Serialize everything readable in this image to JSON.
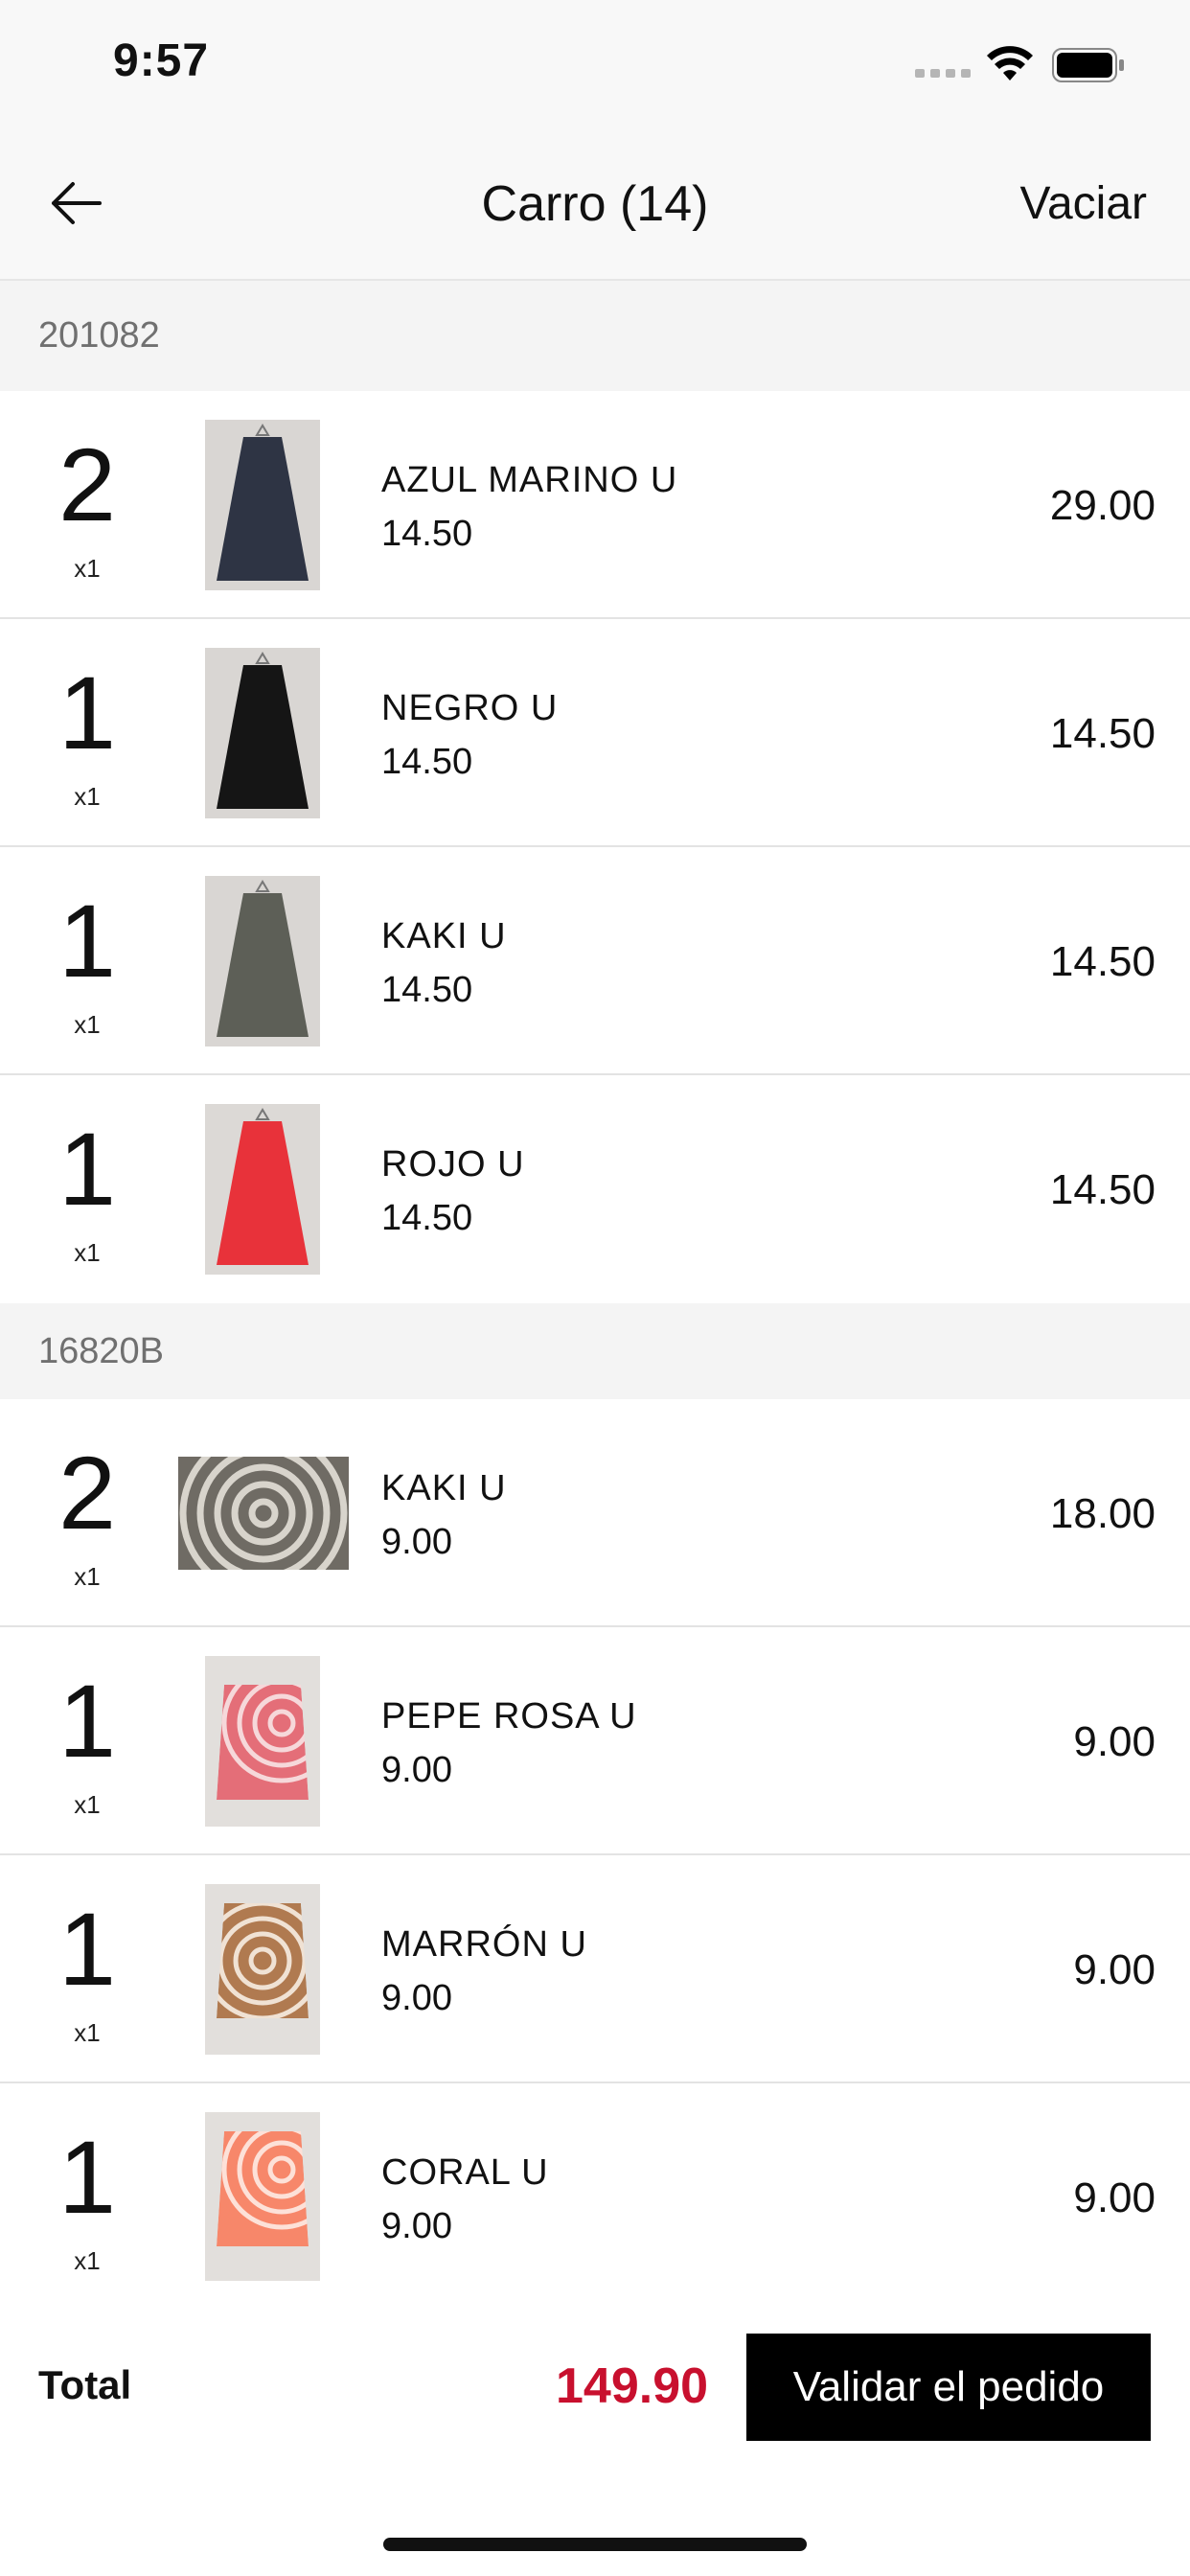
{
  "status_bar": {
    "time": "9:57"
  },
  "header": {
    "title": "Carro (14)",
    "clear_label": "Vaciar",
    "back_icon": "arrow-left-icon"
  },
  "sections": [
    {
      "code": "201082",
      "items": [
        {
          "qty": "2",
          "multiplier": "x1",
          "name": "AZUL MARINO  U",
          "unit_price": "14.50",
          "line_total": "29.00",
          "color": "#2e3444"
        },
        {
          "qty": "1",
          "multiplier": "x1",
          "name": "NEGRO U",
          "unit_price": "14.50",
          "line_total": "14.50",
          "color": "#151515"
        },
        {
          "qty": "1",
          "multiplier": "x1",
          "name": "KAKI U",
          "unit_price": "14.50",
          "line_total": "14.50",
          "color": "#5d5f57"
        },
        {
          "qty": "1",
          "multiplier": "x1",
          "name": "ROJO U",
          "unit_price": "14.50",
          "line_total": "14.50",
          "color": "#e8323a"
        }
      ]
    },
    {
      "code": "16820B",
      "items": [
        {
          "qty": "2",
          "multiplier": "x1",
          "name": "KAKI U",
          "unit_price": "9.00",
          "line_total": "18.00",
          "color": "#6f6b64"
        },
        {
          "qty": "1",
          "multiplier": "x1",
          "name": "PEPE ROSA U",
          "unit_price": "9.00",
          "line_total": "9.00",
          "color": "#e46e78"
        },
        {
          "qty": "1",
          "multiplier": "x1",
          "name": "MARRÓN U",
          "unit_price": "9.00",
          "line_total": "9.00",
          "color": "#b07a50"
        },
        {
          "qty": "1",
          "multiplier": "x1",
          "name": "CORAL U",
          "unit_price": "9.00",
          "line_total": "9.00",
          "color": "#f7876a"
        }
      ]
    }
  ],
  "footer": {
    "total_label": "Total",
    "total_value": "149.90",
    "validate_label": "Validar el pedido",
    "total_color": "#c8102e"
  }
}
